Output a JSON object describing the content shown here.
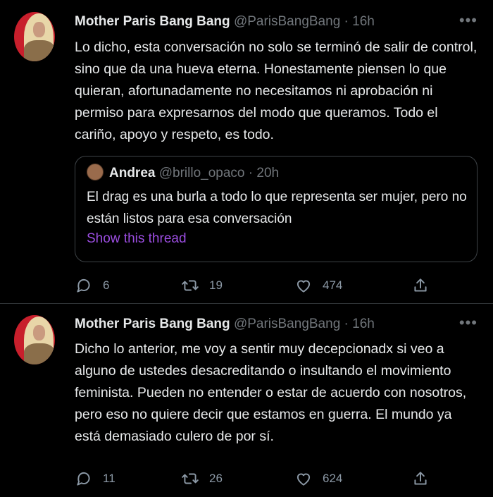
{
  "tweets": [
    {
      "author_name": "Mother Paris Bang Bang",
      "handle": "@ParisBangBang",
      "separator": "·",
      "time": "16h",
      "more": "•••",
      "text": "Lo dicho, esta conversación no solo se terminó de salir de control, sino que da una hueva eterna. Honestamente piensen lo que quieran, afortunadamente no necesitamos ni aprobación ni permiso para expresarnos del modo que queramos. Todo el cariño, apoyo y respeto, es todo.",
      "quote": {
        "author_name": "Andrea",
        "handle": "@brillo_opaco",
        "separator": "·",
        "time": "20h",
        "text": "El drag es una burla a todo lo que representa ser mujer, pero no están listos para esa conversación",
        "show_thread": "Show this thread"
      },
      "replies": "6",
      "retweets": "19",
      "likes": "474"
    },
    {
      "author_name": "Mother Paris Bang Bang",
      "handle": "@ParisBangBang",
      "separator": "·",
      "time": "16h",
      "more": "•••",
      "text": "Dicho lo anterior, me voy a sentir muy decepcionadx si veo a alguno de ustedes desacreditando o insultando el movimiento feminista. Pueden no entender o estar de acuerdo con nosotros, pero eso no quiere decir que estamos en guerra. El mundo ya está demasiado culero de por sí.",
      "replies": "11",
      "retweets": "26",
      "likes": "624"
    }
  ],
  "colors": {
    "background": "#000000",
    "primary_text": "#e7e9ea",
    "secondary_text": "#71767b",
    "link_purple": "#9b4de0",
    "border": "#2f3336"
  },
  "icons": [
    "reply-icon",
    "retweet-icon",
    "like-icon",
    "share-icon",
    "more-icon"
  ]
}
